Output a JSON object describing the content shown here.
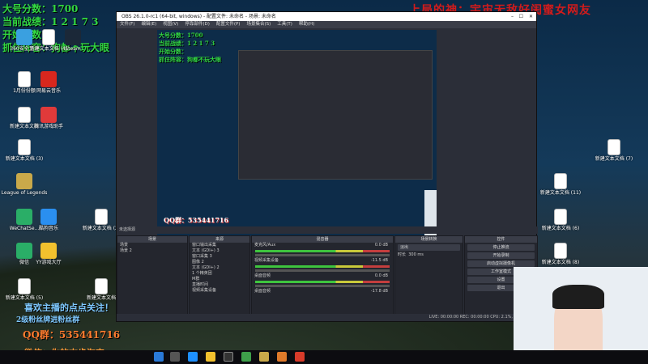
{
  "overlay": {
    "rank_label": "大号分数：1700",
    "record_label": "当前战绩：1 2 1 7 3",
    "hero_label": "开始分数：",
    "lineup_label": "抓住阵容：狗都不玩大眼",
    "top_caption": "上局的神：宇宙无敌好闺蜜女网友",
    "bottom_follow": "喜欢主播的点点关注！",
    "bottom_group_hint": "2级粉丝牌进粉丝群",
    "qq_group": "QQ群：535441716",
    "taobao": "微信：你的末步淘宝"
  },
  "obs": {
    "title": "OBS 26.1.0-rc1 (64-bit, windows) - 配置文件: 未命名 - 场景: 未命名",
    "menu": [
      "文件(F)",
      "编辑(E)",
      "视图(V)",
      "停靠部件(D)",
      "配置文件(P)",
      "场景集合(S)",
      "工具(T)",
      "帮助(H)"
    ],
    "selected_source": "未选择源",
    "scenes_header": "场景",
    "scenes": [
      "场景",
      "场景 2"
    ],
    "sources_header": "来源",
    "sources": [
      "窗口输出采集",
      "文本 (GDI+) 3",
      "窗口采集 3",
      "图像 2",
      "文本 (GDI+) 2",
      "1 个精英团",
      "M群",
      "直播时间",
      "视频采集设备"
    ],
    "mixer_header": "混音器",
    "mixer_tracks": [
      {
        "name": "麦克风/Aux",
        "db": "0.0 dB"
      },
      {
        "name": "视频采集设备",
        "db": "-11.5 dB"
      },
      {
        "name": "桌面音频",
        "db": "0.0 dB"
      }
    ],
    "transition_header": "场景转换",
    "transition_type": "淡出",
    "transition_duration_label": "时长",
    "transition_duration": "300 ms",
    "controls_header": "控件",
    "controls": [
      "停止推流",
      "开始录制",
      "启动虚拟摄像机",
      "工作室模式",
      "设置",
      "退出"
    ],
    "status": "LIVE: 00:00:00   REC: 00:00:00   CPU: 2.1%, 30.00 fps",
    "mixer_bottom": "桌面音频",
    "mixer_bottom_db": "-17.8 dB"
  },
  "desktop_icons": [
    {
      "label": "360安全卫士",
      "color": "#3aa0e0"
    },
    {
      "label": "新建文本文档 (4)",
      "color": "#ffffff"
    },
    {
      "label": "Steam",
      "color": "#1b2838"
    },
    {
      "label": "1月份份额",
      "color": "#ffffff"
    },
    {
      "label": "网易云音乐",
      "color": "#d8271e"
    },
    {
      "label": "新建文本文档",
      "color": "#ffffff"
    },
    {
      "label": "腾讯游戏助手",
      "color": "#e03a3a"
    },
    {
      "label": "新建文本文档 (3)",
      "color": "#ffffff"
    },
    {
      "label": "League of Legends",
      "color": "#c9a94a"
    },
    {
      "label": "WeChatSe...",
      "color": "#2aae67"
    },
    {
      "label": "酷狗音乐",
      "color": "#2a8ff0"
    },
    {
      "label": "新建文本文档 (2)",
      "color": "#ffffff"
    },
    {
      "label": "微信",
      "color": "#2aae67"
    },
    {
      "label": "YY游戏大厅",
      "color": "#f2c12e"
    },
    {
      "label": "新建文本文档",
      "color": "#ffffff"
    },
    {
      "label": "新建文本文档 (11)",
      "color": "#ffffff"
    },
    {
      "label": "新建文本文档 (7)",
      "color": "#ffffff"
    },
    {
      "label": "新建文本文档 (6)",
      "color": "#ffffff"
    },
    {
      "label": "新建文本文档 (8)",
      "color": "#ffffff"
    },
    {
      "label": "新建文本文档 (5)",
      "color": "#ffffff"
    }
  ]
}
